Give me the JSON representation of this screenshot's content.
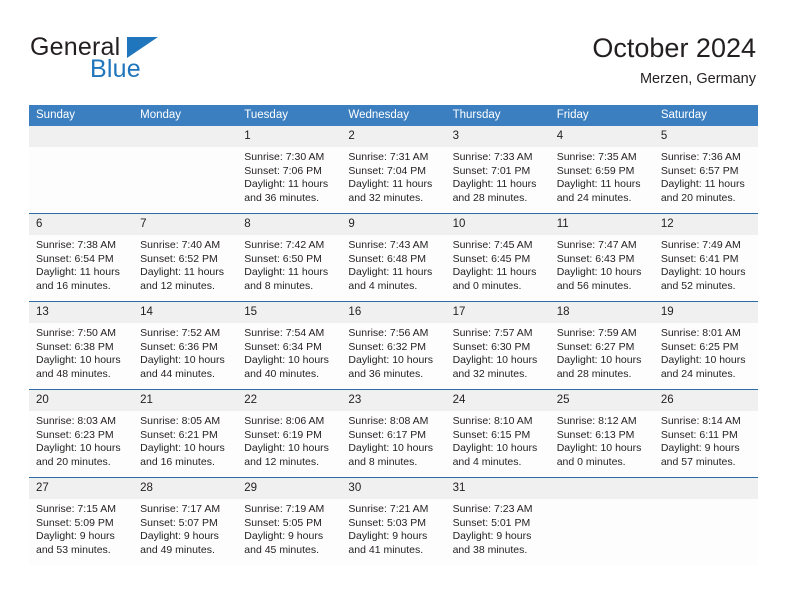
{
  "brand": {
    "name_part1": "General",
    "name_part2": "Blue",
    "accent_color": "#1f76bc",
    "triangle_icon": "triangle-icon"
  },
  "header": {
    "title": "October 2024",
    "subtitle": "Merzen, Germany",
    "header_bg_color": "#3c7fc0",
    "row_divider_color": "#2d6da3",
    "date_band_color": "#f0f0f0"
  },
  "weekday_headers": [
    "Sunday",
    "Monday",
    "Tuesday",
    "Wednesday",
    "Thursday",
    "Friday",
    "Saturday"
  ],
  "labels": {
    "sunrise_prefix": "Sunrise:",
    "sunset_prefix": "Sunset:",
    "daylight_prefix": "Daylight:"
  },
  "weeks": [
    [
      {
        "day": "",
        "empty": true
      },
      {
        "day": "",
        "empty": true
      },
      {
        "day": "1",
        "sunrise": "Sunrise: 7:30 AM",
        "sunset": "Sunset: 7:06 PM",
        "daylight_line1": "Daylight: 11 hours",
        "daylight_line2": "and 36 minutes."
      },
      {
        "day": "2",
        "sunrise": "Sunrise: 7:31 AM",
        "sunset": "Sunset: 7:04 PM",
        "daylight_line1": "Daylight: 11 hours",
        "daylight_line2": "and 32 minutes."
      },
      {
        "day": "3",
        "sunrise": "Sunrise: 7:33 AM",
        "sunset": "Sunset: 7:01 PM",
        "daylight_line1": "Daylight: 11 hours",
        "daylight_line2": "and 28 minutes."
      },
      {
        "day": "4",
        "sunrise": "Sunrise: 7:35 AM",
        "sunset": "Sunset: 6:59 PM",
        "daylight_line1": "Daylight: 11 hours",
        "daylight_line2": "and 24 minutes."
      },
      {
        "day": "5",
        "sunrise": "Sunrise: 7:36 AM",
        "sunset": "Sunset: 6:57 PM",
        "daylight_line1": "Daylight: 11 hours",
        "daylight_line2": "and 20 minutes."
      }
    ],
    [
      {
        "day": "6",
        "sunrise": "Sunrise: 7:38 AM",
        "sunset": "Sunset: 6:54 PM",
        "daylight_line1": "Daylight: 11 hours",
        "daylight_line2": "and 16 minutes."
      },
      {
        "day": "7",
        "sunrise": "Sunrise: 7:40 AM",
        "sunset": "Sunset: 6:52 PM",
        "daylight_line1": "Daylight: 11 hours",
        "daylight_line2": "and 12 minutes."
      },
      {
        "day": "8",
        "sunrise": "Sunrise: 7:42 AM",
        "sunset": "Sunset: 6:50 PM",
        "daylight_line1": "Daylight: 11 hours",
        "daylight_line2": "and 8 minutes."
      },
      {
        "day": "9",
        "sunrise": "Sunrise: 7:43 AM",
        "sunset": "Sunset: 6:48 PM",
        "daylight_line1": "Daylight: 11 hours",
        "daylight_line2": "and 4 minutes."
      },
      {
        "day": "10",
        "sunrise": "Sunrise: 7:45 AM",
        "sunset": "Sunset: 6:45 PM",
        "daylight_line1": "Daylight: 11 hours",
        "daylight_line2": "and 0 minutes."
      },
      {
        "day": "11",
        "sunrise": "Sunrise: 7:47 AM",
        "sunset": "Sunset: 6:43 PM",
        "daylight_line1": "Daylight: 10 hours",
        "daylight_line2": "and 56 minutes."
      },
      {
        "day": "12",
        "sunrise": "Sunrise: 7:49 AM",
        "sunset": "Sunset: 6:41 PM",
        "daylight_line1": "Daylight: 10 hours",
        "daylight_line2": "and 52 minutes."
      }
    ],
    [
      {
        "day": "13",
        "sunrise": "Sunrise: 7:50 AM",
        "sunset": "Sunset: 6:38 PM",
        "daylight_line1": "Daylight: 10 hours",
        "daylight_line2": "and 48 minutes."
      },
      {
        "day": "14",
        "sunrise": "Sunrise: 7:52 AM",
        "sunset": "Sunset: 6:36 PM",
        "daylight_line1": "Daylight: 10 hours",
        "daylight_line2": "and 44 minutes."
      },
      {
        "day": "15",
        "sunrise": "Sunrise: 7:54 AM",
        "sunset": "Sunset: 6:34 PM",
        "daylight_line1": "Daylight: 10 hours",
        "daylight_line2": "and 40 minutes."
      },
      {
        "day": "16",
        "sunrise": "Sunrise: 7:56 AM",
        "sunset": "Sunset: 6:32 PM",
        "daylight_line1": "Daylight: 10 hours",
        "daylight_line2": "and 36 minutes."
      },
      {
        "day": "17",
        "sunrise": "Sunrise: 7:57 AM",
        "sunset": "Sunset: 6:30 PM",
        "daylight_line1": "Daylight: 10 hours",
        "daylight_line2": "and 32 minutes."
      },
      {
        "day": "18",
        "sunrise": "Sunrise: 7:59 AM",
        "sunset": "Sunset: 6:27 PM",
        "daylight_line1": "Daylight: 10 hours",
        "daylight_line2": "and 28 minutes."
      },
      {
        "day": "19",
        "sunrise": "Sunrise: 8:01 AM",
        "sunset": "Sunset: 6:25 PM",
        "daylight_line1": "Daylight: 10 hours",
        "daylight_line2": "and 24 minutes."
      }
    ],
    [
      {
        "day": "20",
        "sunrise": "Sunrise: 8:03 AM",
        "sunset": "Sunset: 6:23 PM",
        "daylight_line1": "Daylight: 10 hours",
        "daylight_line2": "and 20 minutes."
      },
      {
        "day": "21",
        "sunrise": "Sunrise: 8:05 AM",
        "sunset": "Sunset: 6:21 PM",
        "daylight_line1": "Daylight: 10 hours",
        "daylight_line2": "and 16 minutes."
      },
      {
        "day": "22",
        "sunrise": "Sunrise: 8:06 AM",
        "sunset": "Sunset: 6:19 PM",
        "daylight_line1": "Daylight: 10 hours",
        "daylight_line2": "and 12 minutes."
      },
      {
        "day": "23",
        "sunrise": "Sunrise: 8:08 AM",
        "sunset": "Sunset: 6:17 PM",
        "daylight_line1": "Daylight: 10 hours",
        "daylight_line2": "and 8 minutes."
      },
      {
        "day": "24",
        "sunrise": "Sunrise: 8:10 AM",
        "sunset": "Sunset: 6:15 PM",
        "daylight_line1": "Daylight: 10 hours",
        "daylight_line2": "and 4 minutes."
      },
      {
        "day": "25",
        "sunrise": "Sunrise: 8:12 AM",
        "sunset": "Sunset: 6:13 PM",
        "daylight_line1": "Daylight: 10 hours",
        "daylight_line2": "and 0 minutes."
      },
      {
        "day": "26",
        "sunrise": "Sunrise: 8:14 AM",
        "sunset": "Sunset: 6:11 PM",
        "daylight_line1": "Daylight: 9 hours",
        "daylight_line2": "and 57 minutes."
      }
    ],
    [
      {
        "day": "27",
        "sunrise": "Sunrise: 7:15 AM",
        "sunset": "Sunset: 5:09 PM",
        "daylight_line1": "Daylight: 9 hours",
        "daylight_line2": "and 53 minutes."
      },
      {
        "day": "28",
        "sunrise": "Sunrise: 7:17 AM",
        "sunset": "Sunset: 5:07 PM",
        "daylight_line1": "Daylight: 9 hours",
        "daylight_line2": "and 49 minutes."
      },
      {
        "day": "29",
        "sunrise": "Sunrise: 7:19 AM",
        "sunset": "Sunset: 5:05 PM",
        "daylight_line1": "Daylight: 9 hours",
        "daylight_line2": "and 45 minutes."
      },
      {
        "day": "30",
        "sunrise": "Sunrise: 7:21 AM",
        "sunset": "Sunset: 5:03 PM",
        "daylight_line1": "Daylight: 9 hours",
        "daylight_line2": "and 41 minutes."
      },
      {
        "day": "31",
        "sunrise": "Sunrise: 7:23 AM",
        "sunset": "Sunset: 5:01 PM",
        "daylight_line1": "Daylight: 9 hours",
        "daylight_line2": "and 38 minutes."
      },
      {
        "day": "",
        "empty": true
      },
      {
        "day": "",
        "empty": true
      }
    ]
  ]
}
